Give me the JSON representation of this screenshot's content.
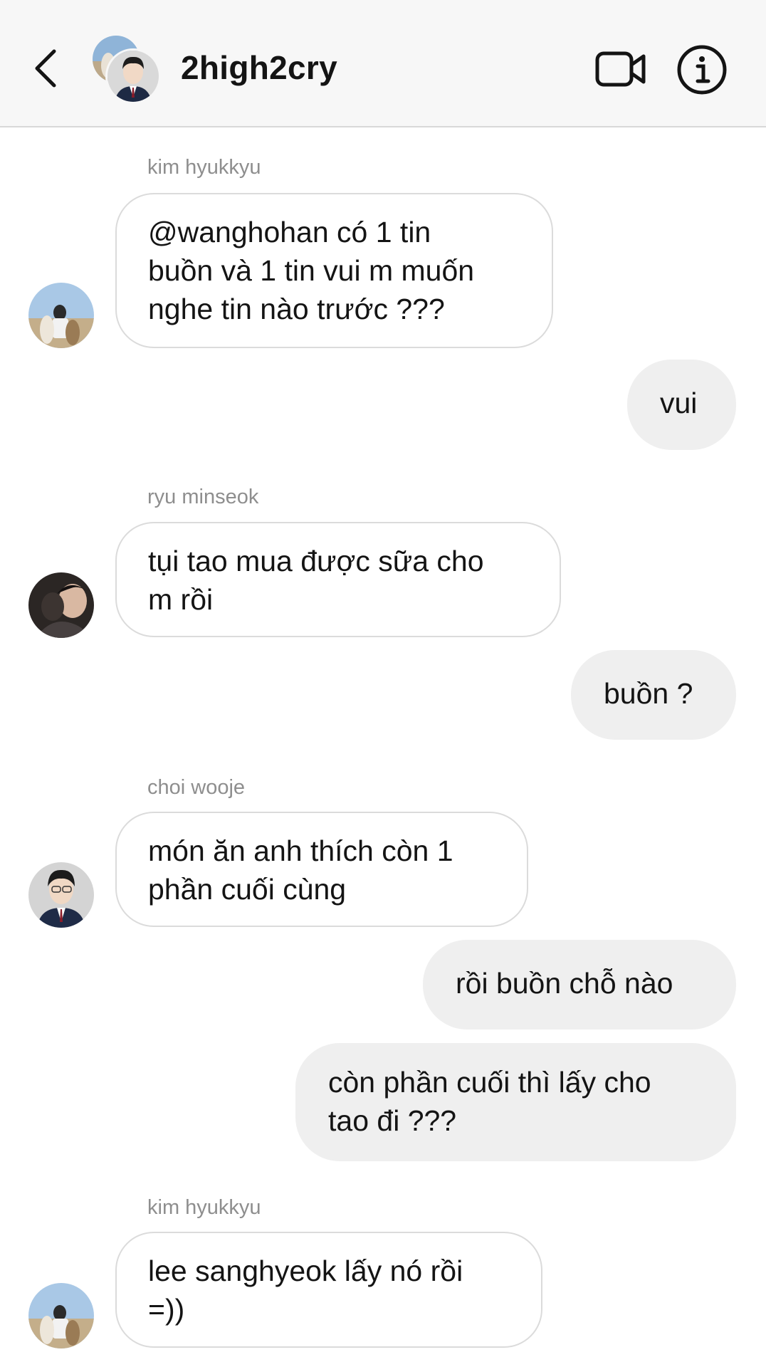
{
  "header": {
    "title": "2high2cry",
    "back_icon": "chevron-left-icon",
    "video_icon": "video-camera-icon",
    "info_icon": "info-circle-icon"
  },
  "messages": [
    {
      "direction": "incoming",
      "sender": "kim hyukkyu",
      "avatar": "alpaca-photo",
      "lines": [
        "@wanghohan có 1 tin",
        "buồn và 1 tin vui m muốn",
        "nghe tin nào trước ???"
      ]
    },
    {
      "direction": "outgoing",
      "lines": [
        "vui"
      ]
    },
    {
      "direction": "incoming",
      "sender": "ryu minseok",
      "avatar": "dark-selfie-photo",
      "lines": [
        "tụi tao mua được sữa cho",
        "m rồi"
      ]
    },
    {
      "direction": "outgoing",
      "lines": [
        "buồn ?"
      ]
    },
    {
      "direction": "incoming",
      "sender": "choi wooje",
      "avatar": "suit-portrait-photo",
      "lines": [
        "món ăn anh thích còn 1",
        "phần cuối cùng"
      ]
    },
    {
      "direction": "outgoing",
      "lines": [
        "rồi buồn chỗ nào"
      ]
    },
    {
      "direction": "outgoing",
      "lines": [
        "còn phần cuối thì lấy cho",
        "tao đi ???"
      ]
    },
    {
      "direction": "incoming",
      "sender": "kim hyukkyu",
      "avatar": "alpaca-photo",
      "lines": [
        "lee sanghyeok lấy nó rồi",
        "=))"
      ]
    }
  ],
  "colors": {
    "header_bg": "#f7f7f7",
    "outgoing_bubble": "#efefef",
    "incoming_border": "#dbdbdb",
    "sender_name": "#8e8e8e",
    "text": "#141414"
  }
}
